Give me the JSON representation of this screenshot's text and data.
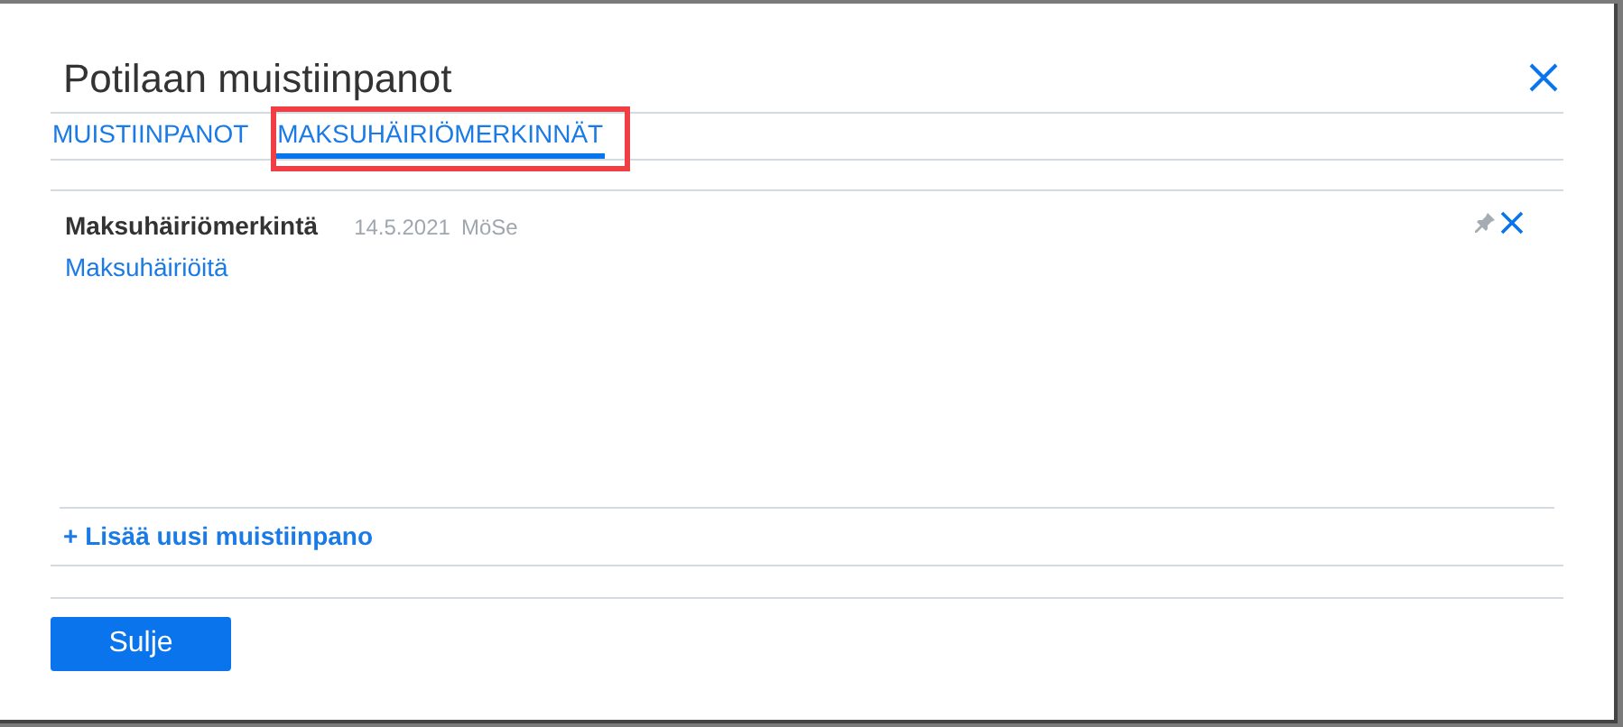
{
  "dialog": {
    "title": "Potilaan muistiinpanot"
  },
  "tabs": [
    {
      "label": "MUISTIINPANOT",
      "selected": false,
      "highlighted": false
    },
    {
      "label": "MAKSUHÄIRIÖMERKINNÄT",
      "selected": true,
      "highlighted": true
    }
  ],
  "notes": [
    {
      "title": "Maksuhäiriömerkintä",
      "date": "14.5.2021",
      "author": "MöSe",
      "text": "Maksuhäiriöitä"
    }
  ],
  "add_note": "+ Lisää uusi muistiinpano",
  "close_button": "Sulje"
}
